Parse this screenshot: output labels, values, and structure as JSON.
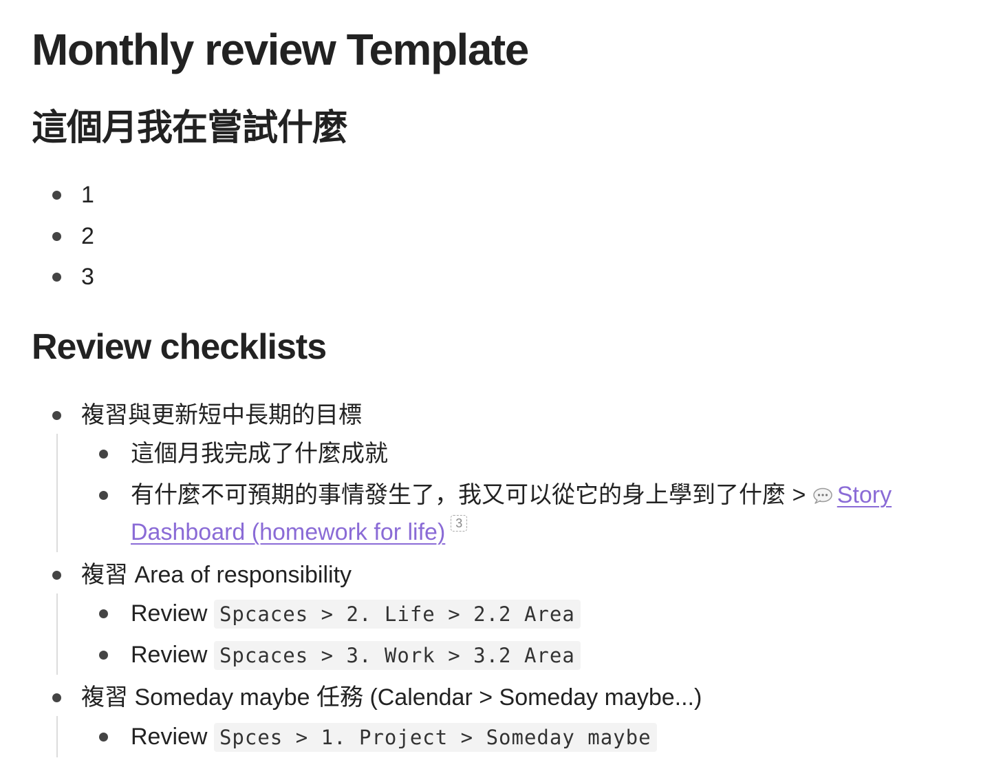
{
  "title": "Monthly review Template",
  "section_trying": {
    "heading": "這個月我在嘗試什麼",
    "items": [
      "1",
      "2",
      "3"
    ]
  },
  "section_review": {
    "heading": "Review checklists",
    "items": [
      {
        "label": "複習與更新短中長期的目標",
        "children": [
          {
            "text": "這個月我完成了什麼成就"
          },
          {
            "text": "有什麼不可預期的事情發生了，我又可以從它的身上學到了什麼 > ",
            "link_line1": "Story",
            "link_line2": "Dashboard (homework for life)",
            "link_icon": "speech-bubble-icon",
            "footnote": "3"
          }
        ]
      },
      {
        "label": "複習 Area of responsibility",
        "children": [
          {
            "prefix": "Review",
            "code": "Spcaces > 2. Life > 2.2 Area"
          },
          {
            "prefix": "Review",
            "code": "Spcaces > 3. Work > 3.2 Area"
          }
        ]
      },
      {
        "label": "複習 Someday maybe 任務 (Calendar > Someday maybe...)",
        "children": [
          {
            "prefix": "Review",
            "code": "Spces > 1. Project > Someday maybe"
          }
        ]
      }
    ]
  },
  "colors": {
    "text": "#222222",
    "link": "#8a6bd6",
    "code_bg": "#f3f3f3",
    "guide": "#dcdcdc"
  }
}
